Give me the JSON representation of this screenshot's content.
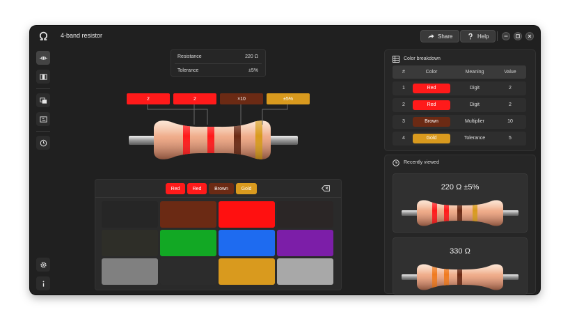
{
  "app": {
    "title": "4-band resistor",
    "icon": "ohm-icon"
  },
  "toolbar": {
    "share_label": "Share",
    "help_label": "Help"
  },
  "sidebar": {
    "items": [
      {
        "icon": "resistor-icon",
        "active": true
      },
      {
        "icon": "panel-icon",
        "active": false
      },
      {
        "icon": "layers-icon",
        "active": false
      },
      {
        "icon": "compare-icon",
        "active": false
      },
      {
        "icon": "history-icon",
        "active": false
      }
    ],
    "bottom": [
      {
        "icon": "gear-icon"
      },
      {
        "icon": "info-icon"
      }
    ]
  },
  "readout": {
    "resistance_label": "Resistance",
    "resistance_value": "220 Ω",
    "tolerance_label": "Tolerance",
    "tolerance_value": "±5%"
  },
  "bands": [
    {
      "label": "2",
      "color": "#ff1a1a"
    },
    {
      "label": "2",
      "color": "#ff1a1a"
    },
    {
      "label": "×10",
      "color": "#6b2a14"
    },
    {
      "label": "±5%",
      "color": "#d99a1e"
    }
  ],
  "picker": {
    "chips": [
      {
        "label": "Red",
        "color": "#ff1a1a"
      },
      {
        "label": "Red",
        "color": "#ff1a1a"
      },
      {
        "label": "Brown",
        "color": "#6b2a14"
      },
      {
        "label": "Gold",
        "color": "#d99a1e"
      }
    ],
    "swatches": [
      {
        "name": "black",
        "color": "#262626"
      },
      {
        "name": "brown",
        "color": "#6b2a14"
      },
      {
        "name": "red",
        "color": "#ff1010"
      },
      {
        "name": "none-1",
        "color": "#2b2626"
      },
      {
        "name": "empty-1",
        "color": "#2e2e28"
      },
      {
        "name": "green",
        "color": "#12a824"
      },
      {
        "name": "blue",
        "color": "#1e6bf0"
      },
      {
        "name": "violet",
        "color": "#7c1ea8"
      },
      {
        "name": "grey",
        "color": "#808080"
      },
      {
        "name": "empty-2",
        "color": "#2c2c2c"
      },
      {
        "name": "gold",
        "color": "#d99a1e"
      },
      {
        "name": "silver",
        "color": "#a8a8a8"
      }
    ]
  },
  "breakdown": {
    "title": "Color breakdown",
    "headers": [
      "#",
      "Color",
      "Meaning",
      "Value"
    ],
    "rows": [
      {
        "n": "1",
        "color": "Red",
        "hex": "#ff1a1a",
        "meaning": "Digit",
        "value": "2"
      },
      {
        "n": "2",
        "color": "Red",
        "hex": "#ff1a1a",
        "meaning": "Digit",
        "value": "2"
      },
      {
        "n": "3",
        "color": "Brown",
        "hex": "#6b2a14",
        "meaning": "Multiplier",
        "value": "10"
      },
      {
        "n": "4",
        "color": "Gold",
        "hex": "#d99a1e",
        "meaning": "Tolerance",
        "value": "5"
      }
    ]
  },
  "recent": {
    "title": "Recently viewed",
    "cards": [
      {
        "title": "220 Ω  ±5%",
        "bands": [
          "#ff1a1a",
          "#ff1a1a",
          "#6b2a14",
          "#d99a1e"
        ]
      },
      {
        "title": "330 Ω",
        "bands": [
          "#f07a20",
          "#f07a20",
          "#6b2a14"
        ]
      }
    ]
  }
}
